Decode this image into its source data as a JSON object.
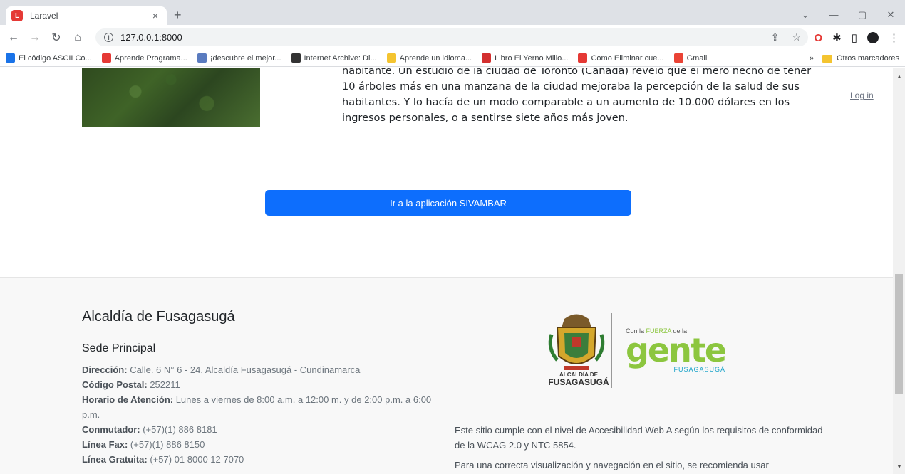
{
  "browser": {
    "tab_title": "Laravel",
    "tab_close": "×",
    "new_tab": "+",
    "url": "127.0.0.1:8000",
    "win_min": "—",
    "win_max": "▢",
    "win_close": "✕",
    "dropdown": "⌄"
  },
  "bookmarks": [
    {
      "label": "El código ASCII Co...",
      "color": "#1a73e8"
    },
    {
      "label": "Aprende Programa...",
      "color": "#e53935"
    },
    {
      "label": "¡descubre el mejor...",
      "color": "#5a7bbf"
    },
    {
      "label": "Internet Archive: Di...",
      "color": "#333333"
    },
    {
      "label": "Aprende un idioma...",
      "color": "#f4c430"
    },
    {
      "label": "Libro El Yerno Millo...",
      "color": "#d32f2f"
    },
    {
      "label": "Como Eliminar cue...",
      "color": "#e53935"
    },
    {
      "label": "Gmail",
      "color": "#ea4335"
    }
  ],
  "bookmarks_more": "»",
  "bookmarks_other": "Otros marcadores",
  "article": {
    "text": "habitante. Un estudio de la ciudad de Toronto (Canadá) reveló que el mero hecho de tener 10 árboles más en una manzana de la ciudad mejoraba la percepción de la salud de sus habitantes. Y lo hacía de un modo comparable a un aumento de 10.000 dólares en los ingresos personales, o a sentirse siete años más joven."
  },
  "nav": {
    "login": "Log in"
  },
  "cta": {
    "label": "Ir a la aplicación SIVAMBAR"
  },
  "footer": {
    "title": "Alcaldía de Fusagasugá",
    "subtitle": "Sede Principal",
    "lines": [
      {
        "label": "Dirección:",
        "value": " Calle. 6 N° 6 - 24, Alcaldía Fusagasugá - Cundinamarca"
      },
      {
        "label": "Código Postal:",
        "value": " 252211"
      },
      {
        "label": "Horario de Atención:",
        "value": " Lunes a viernes de 8:00 a.m. a 12:00 m. y de 2:00 p.m. a 6:00 p.m."
      },
      {
        "label": "Conmutador:",
        "value": " (+57)(1) 886 8181"
      },
      {
        "label": "Línea Fax:",
        "value": " (+57)(1) 886 8150"
      },
      {
        "label": "Línea Gratuita:",
        "value": " (+57) 01 8000 12 7070"
      }
    ],
    "logo_alcaldia_small": "ALCALDÍA DE",
    "logo_alcaldia_big": "FUSAGASUGÁ",
    "logo_slogan_pre": "Con la ",
    "logo_slogan_em": "FUERZA",
    "logo_slogan_post": " de la",
    "logo_gente": "gente",
    "logo_gente_sub": "FUSAGASUGÁ",
    "accessibility": "Este sitio cumple con el nivel de Accesibilidad Web A según los requisitos de conformidad de la WCAG 2.0 y NTC 5854.",
    "accessibility_2": "Para una correcta visualización y navegación en el sitio, se recomienda usar"
  },
  "colors": {
    "primary_button": "#0d6efd",
    "gente_green": "#8cc63f",
    "gente_blue": "#1aa3c9"
  }
}
